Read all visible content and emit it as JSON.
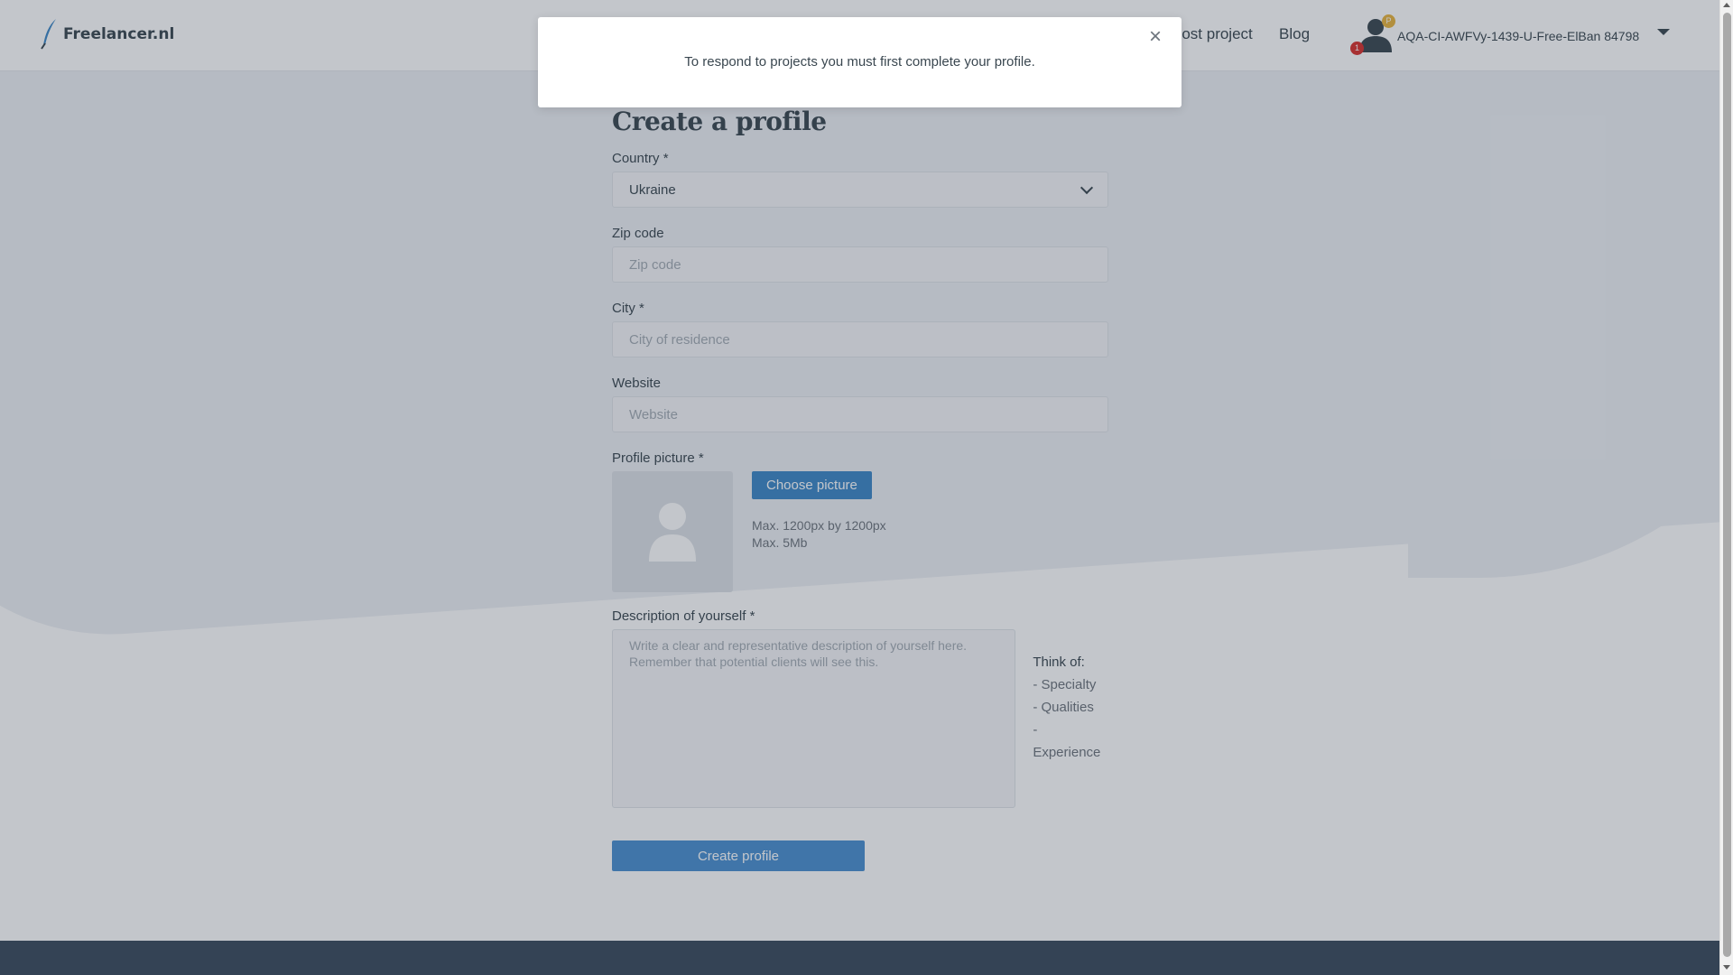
{
  "header": {
    "logo_text": "Freelancer.nl",
    "nav": {
      "post_project": "Post project",
      "blog": "Blog"
    },
    "user": {
      "badge_p": "P",
      "notifications": "1",
      "username": "AQA-CI-AWFVy-1439-U-Free-ElBan 84798"
    }
  },
  "modal": {
    "message": "To respond to projects you must first complete your profile.",
    "close_symbol": "×"
  },
  "form": {
    "title": "Create a profile",
    "country": {
      "label": "Country *",
      "value": "Ukraine"
    },
    "zip": {
      "label": "Zip code",
      "placeholder": "Zip code"
    },
    "city": {
      "label": "City *",
      "placeholder": "City of residence"
    },
    "website": {
      "label": "Website",
      "placeholder": "Website"
    },
    "picture": {
      "label": "Profile picture *",
      "button": "Choose picture",
      "max_size": "Max. 1200px by 1200px",
      "max_file": "Max. 5Mb"
    },
    "description": {
      "label": "Description of yourself *",
      "placeholder": "Write a clear and representative description of yourself here. Remember that potential clients will see this.",
      "think_title": "Think of:",
      "think_items": [
        "- Specialty",
        "- Qualities",
        "- Experience"
      ]
    },
    "submit": "Create profile"
  },
  "colors": {
    "primary": "#3c87c6",
    "text": "#3a4750",
    "footer": "#3a4a5c",
    "badge_red": "#d9302c",
    "badge_gold": "#e8b33c"
  },
  "icons": [
    "feather-logo-icon",
    "user-icon",
    "chevron-down-icon",
    "close-icon",
    "avatar-placeholder-icon"
  ]
}
